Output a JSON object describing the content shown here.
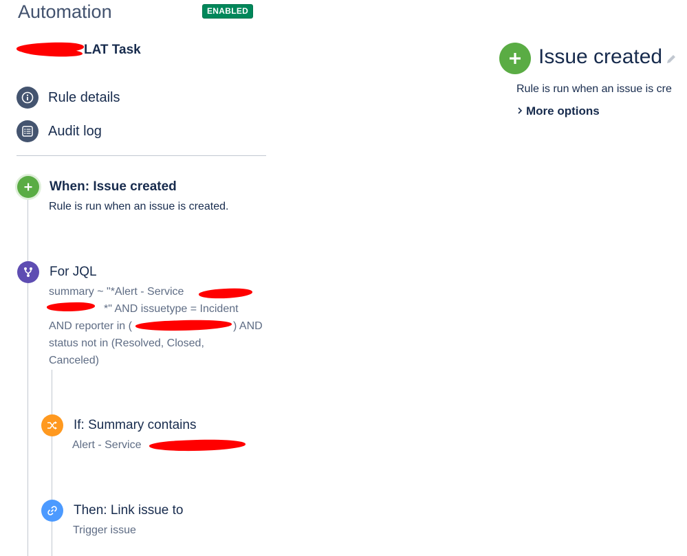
{
  "header": {
    "title": "Automation",
    "status_badge": "ENABLED",
    "rule_name_visible": "LAT Task"
  },
  "nav": [
    {
      "label": "Rule details",
      "icon": "info-icon"
    },
    {
      "label": "Audit log",
      "icon": "list-icon"
    }
  ],
  "steps": {
    "trigger": {
      "icon": "plus-icon",
      "title": "When: Issue created",
      "description": "Rule is run when an issue is created."
    },
    "branch": {
      "icon": "branch-icon",
      "title": "For JQL",
      "jql_line1": "summary ~ \"*Alert - Service",
      "jql_line2": "*\" AND issuetype = Incident",
      "jql_line3_start": "AND reporter in (",
      "jql_line3_end": ") AND",
      "jql_line4": "status not in (Resolved, Closed,",
      "jql_line5": "Canceled)"
    },
    "condition": {
      "icon": "shuffle-icon",
      "title": "If: Summary contains",
      "value": "Alert - Service"
    },
    "action": {
      "icon": "link-icon",
      "title": "Then: Link issue to",
      "value": "Trigger issue"
    }
  },
  "panel": {
    "title": "Issue created",
    "description": "Rule is run when an issue is cre",
    "more_options": "More options"
  },
  "colors": {
    "enabled_badge": "#00875a",
    "trigger_green": "#5aac44",
    "branch_purple": "#5e4db2",
    "condition_orange": "#ff991f",
    "action_blue": "#4c9aff",
    "redaction": "#ff0000"
  }
}
